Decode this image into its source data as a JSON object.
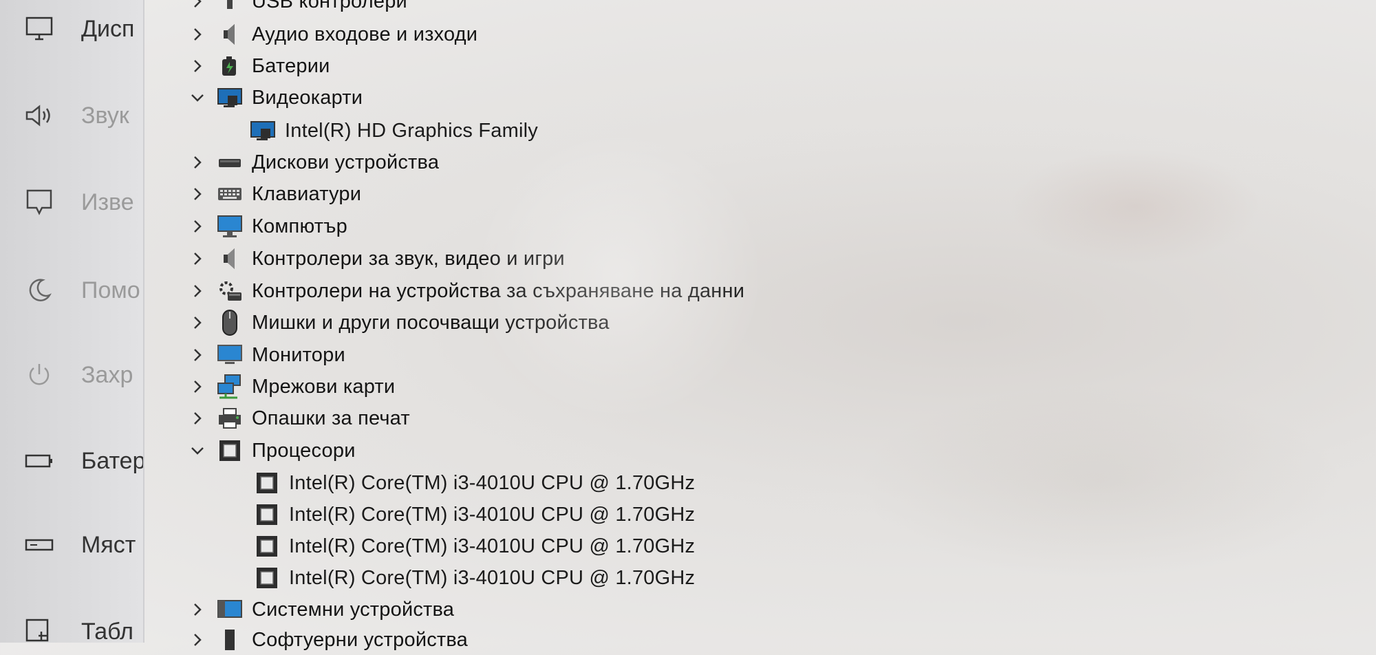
{
  "sidebar": {
    "items": [
      {
        "label": "Дисп",
        "icon": "display-icon",
        "dim": false
      },
      {
        "label": "Звук",
        "icon": "speaker-icon",
        "dim": true
      },
      {
        "label": "Изве",
        "icon": "notification-icon",
        "dim": true
      },
      {
        "label": "Помо",
        "icon": "moon-icon",
        "dim": true
      },
      {
        "label": "Захр",
        "icon": "power-icon",
        "dim": true
      },
      {
        "label": "Батер",
        "icon": "battery-icon",
        "dim": false
      },
      {
        "label": "Мяст",
        "icon": "storage-icon",
        "dim": false
      },
      {
        "label": "Табл",
        "icon": "tablet-icon",
        "dim": false
      }
    ]
  },
  "tree": {
    "nodes": [
      {
        "label": "USB контролери",
        "icon": "usb-icon",
        "expanded": false,
        "level": 0
      },
      {
        "label": "Аудио входове и изходи",
        "icon": "audio-io-icon",
        "expanded": false,
        "level": 0
      },
      {
        "label": "Батерии",
        "icon": "battery-device-icon",
        "expanded": false,
        "level": 0
      },
      {
        "label": "Видеокарти",
        "icon": "display-adapter-icon",
        "expanded": true,
        "level": 0
      },
      {
        "label": "Intel(R) HD Graphics Family",
        "icon": "display-adapter-icon",
        "level": 1
      },
      {
        "label": "Дискови устройства",
        "icon": "disk-drive-icon",
        "expanded": false,
        "level": 0
      },
      {
        "label": "Клавиатури",
        "icon": "keyboard-icon",
        "expanded": false,
        "level": 0
      },
      {
        "label": "Компютър",
        "icon": "computer-icon",
        "expanded": false,
        "level": 0
      },
      {
        "label": "Контролери за звук, видео и игри",
        "icon": "sound-controller-icon",
        "expanded": false,
        "level": 0
      },
      {
        "label": "Контролери на устройства за съхраняване на данни",
        "icon": "storage-controller-icon",
        "expanded": false,
        "level": 0
      },
      {
        "label": "Мишки и други посочващи устройства",
        "icon": "mouse-icon",
        "expanded": false,
        "level": 0
      },
      {
        "label": "Монитори",
        "icon": "monitor-icon",
        "expanded": false,
        "level": 0
      },
      {
        "label": "Мрежови карти",
        "icon": "network-adapter-icon",
        "expanded": false,
        "level": 0
      },
      {
        "label": "Опашки за печат",
        "icon": "printer-icon",
        "expanded": false,
        "level": 0
      },
      {
        "label": "Процесори",
        "icon": "processor-icon",
        "expanded": true,
        "level": 0
      },
      {
        "label": "Intel(R) Core(TM) i3-4010U CPU @ 1.70GHz",
        "icon": "processor-icon",
        "level": 1
      },
      {
        "label": "Intel(R) Core(TM) i3-4010U CPU @ 1.70GHz",
        "icon": "processor-icon",
        "level": 1
      },
      {
        "label": "Intel(R) Core(TM) i3-4010U CPU @ 1.70GHz",
        "icon": "processor-icon",
        "level": 1
      },
      {
        "label": "Intel(R) Core(TM) i3-4010U CPU @ 1.70GHz",
        "icon": "processor-icon",
        "level": 1
      },
      {
        "label": "Системни устройства",
        "icon": "system-device-icon",
        "expanded": false,
        "level": 0
      },
      {
        "label": "Софтуерни устройства",
        "icon": "software-device-icon",
        "expanded": false,
        "level": 0
      }
    ]
  }
}
